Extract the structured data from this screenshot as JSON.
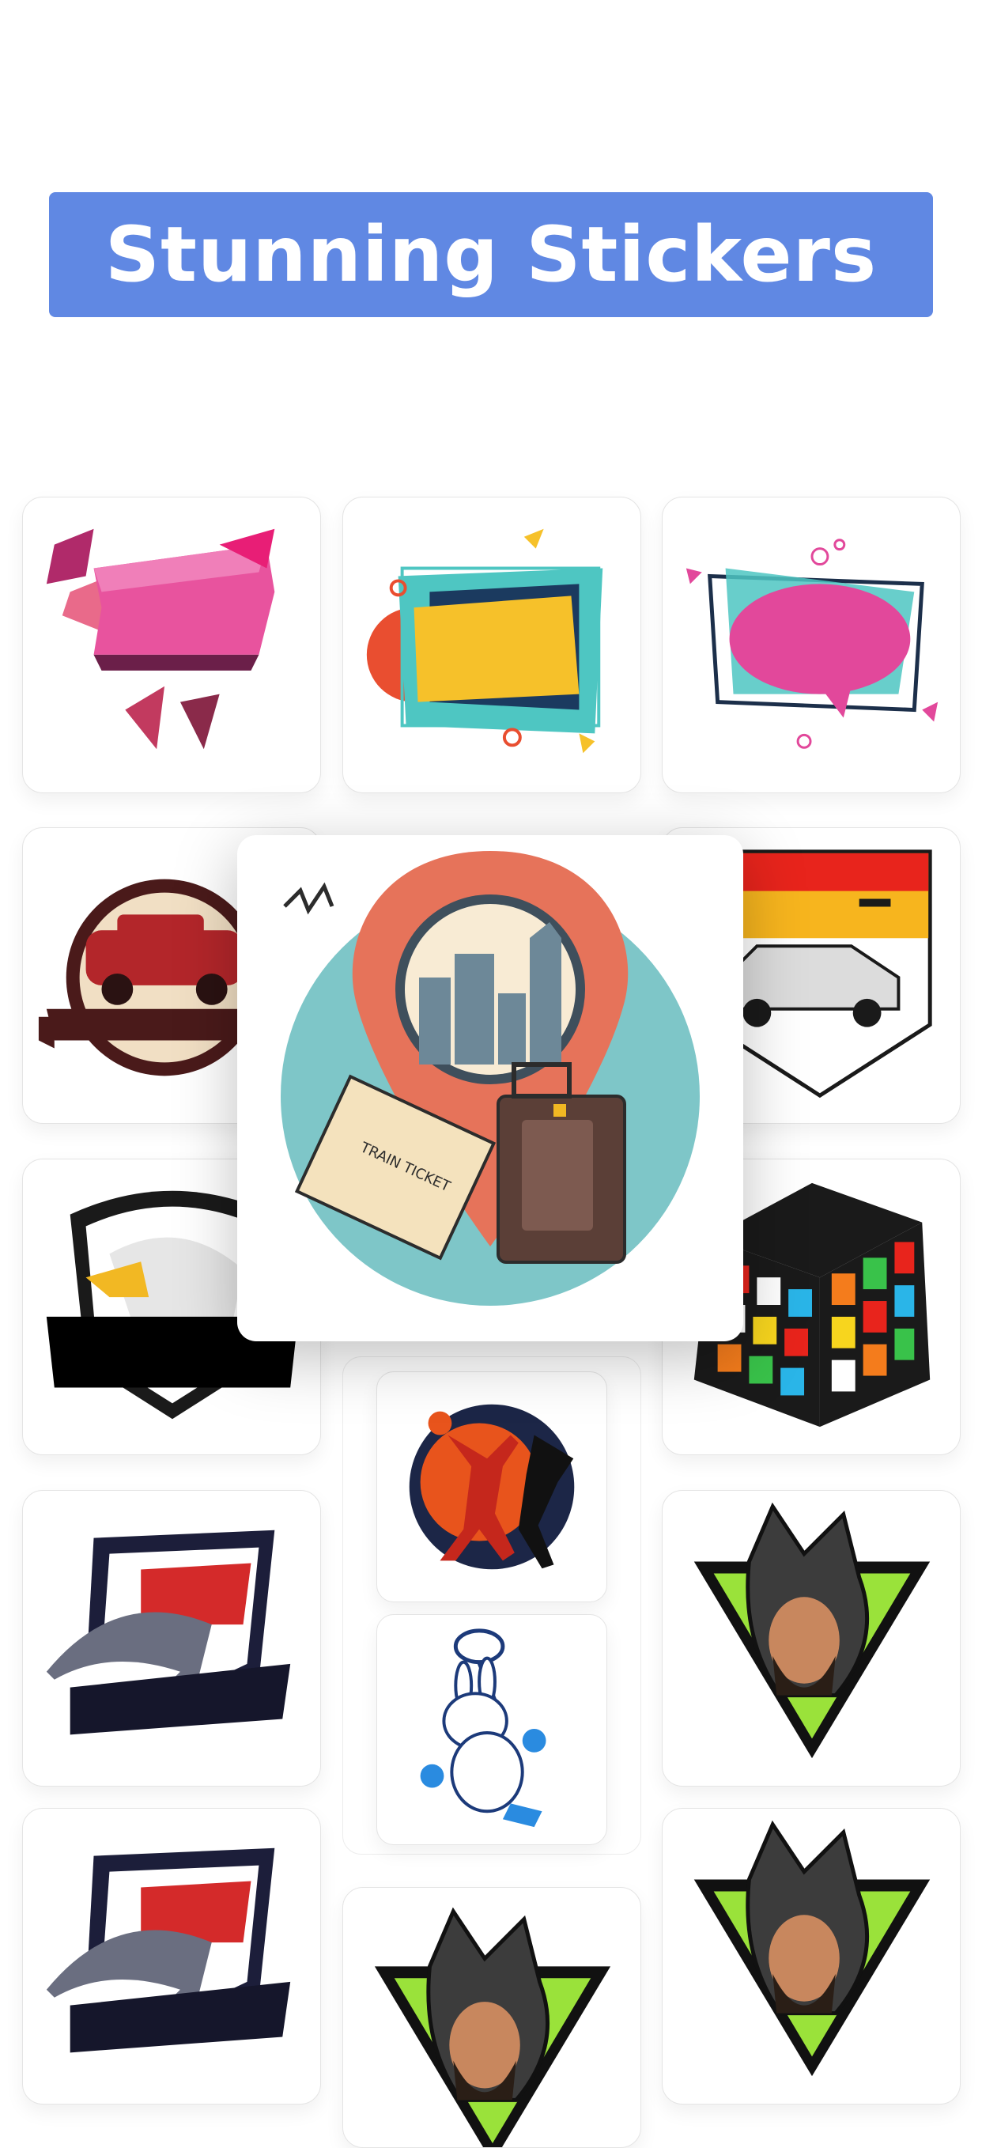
{
  "banner": {
    "title": "Stunning Stickers"
  },
  "colors": {
    "banner": "#6088e3",
    "background": "#ffffff"
  },
  "stickers": [
    {
      "name": "pink-ribbon-banner-sticker"
    },
    {
      "name": "yellow-geometric-frame-sticker"
    },
    {
      "name": "pink-speech-bubble-sticker"
    },
    {
      "name": "vintage-red-car-badge-sticker"
    },
    {
      "name": "taxi-race-car-badge-sticker"
    },
    {
      "name": "eagle-mascot-shield-sticker"
    },
    {
      "name": "rubiks-cube-sticker"
    },
    {
      "name": "basketball-players-sticker"
    },
    {
      "name": "rabbit-tennis-mascot-sticker"
    },
    {
      "name": "wolf-shield-mascot-sticker"
    },
    {
      "name": "wolf-man-triangle-mascot-sticker"
    }
  ],
  "preview": {
    "name": "travel-location-pin-sticker",
    "ticket_text": "TRAIN TICKET"
  }
}
